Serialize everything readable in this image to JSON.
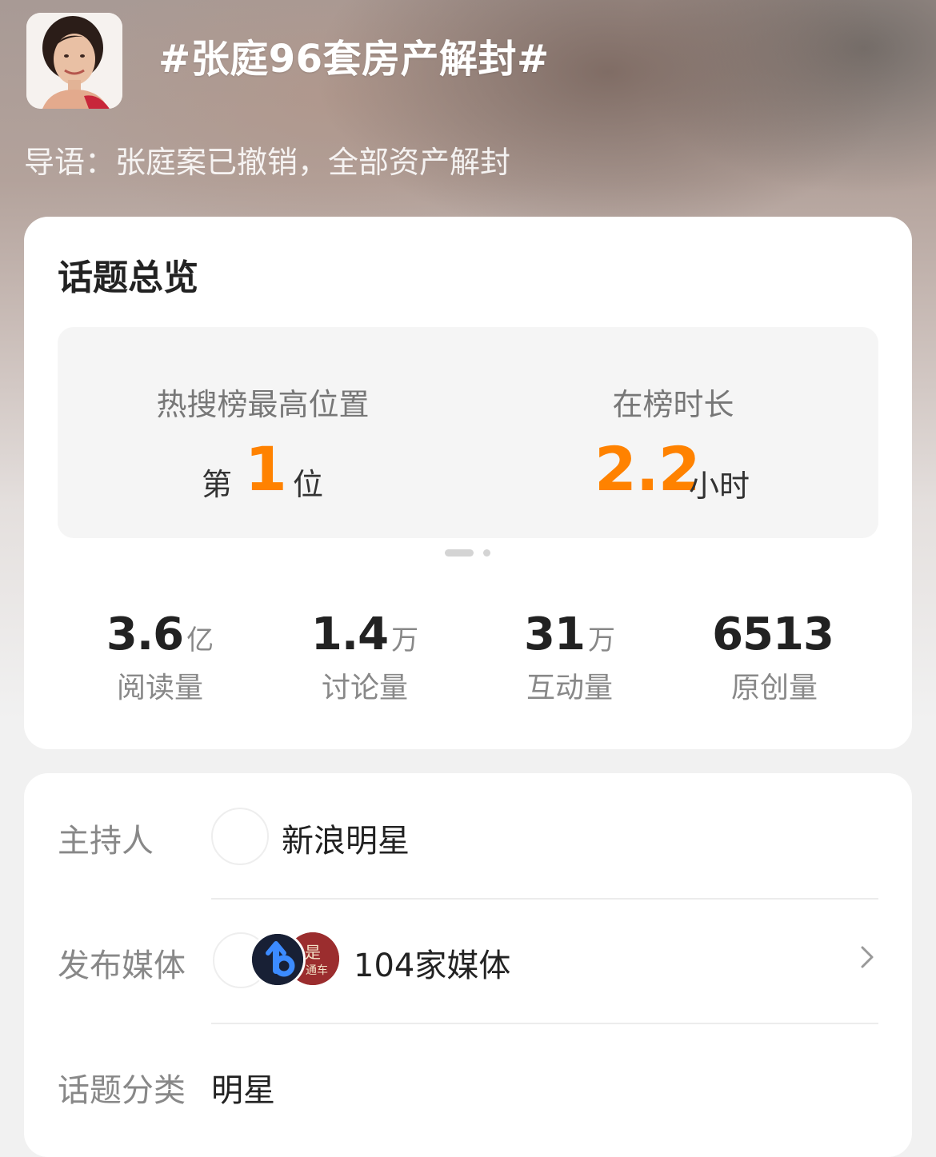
{
  "header": {
    "title": "#张庭96套房产解封#",
    "lead": "导语：张庭案已撤销，全部资产解封"
  },
  "overview": {
    "title": "话题总览",
    "rank": {
      "label": "热搜榜最高位置",
      "prefix": "第",
      "value": "1",
      "suffix": "位"
    },
    "duration": {
      "label": "在榜时长",
      "value": "2.2",
      "unit": "小时"
    },
    "stats": [
      {
        "value": "3.6",
        "unit": "亿",
        "label": "阅读量"
      },
      {
        "value": "1.4",
        "unit": "万",
        "label": "讨论量"
      },
      {
        "value": "31",
        "unit": "万",
        "label": "互动量"
      },
      {
        "value": "6513",
        "unit": "",
        "label": "原创量"
      }
    ]
  },
  "info": {
    "host_label": "主持人",
    "host_name": "新浪明星",
    "media_label": "发布媒体",
    "media_count": "104家媒体",
    "category_label": "话题分类",
    "category_value": "明星"
  },
  "colors": {
    "accent": "#ff8200",
    "text_primary": "#222222",
    "text_secondary": "#888888"
  },
  "icons": {
    "chevron": "chevron-right-icon"
  }
}
